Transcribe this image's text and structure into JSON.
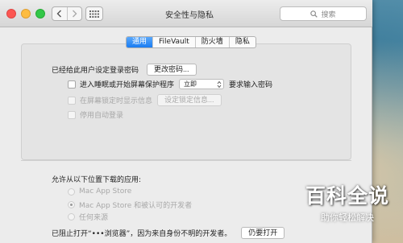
{
  "window": {
    "title": "安全性与隐私",
    "search_placeholder": "搜索"
  },
  "tabs": [
    {
      "label": "通用",
      "active": true
    },
    {
      "label": "FileVault",
      "active": false
    },
    {
      "label": "防火墙",
      "active": false
    },
    {
      "label": "隐私",
      "active": false
    }
  ],
  "general": {
    "password_set_text": "已经给此用户设定登录密码",
    "change_password_button": "更改密码...",
    "require_password_prefix": "进入睡眠或开始屏幕保护程序",
    "require_password_delay": "立即",
    "require_password_suffix": "要求输入密码",
    "show_message_label": "在屏幕锁定时显示信息",
    "set_lock_message_button": "设定锁定信息...",
    "disable_auto_login_label": "停用自动登录"
  },
  "downloads": {
    "heading": "允许从以下位置下载的应用:",
    "options": [
      {
        "label": "Mac App Store",
        "checked": false
      },
      {
        "label": "Mac App Store 和被认可的开发者",
        "checked": true
      },
      {
        "label": "任何来源",
        "checked": false
      }
    ],
    "blocked_text": "已阻止打开“•••浏览器”，因为来自身份不明的开发者。",
    "open_anyway_button": "仍要打开"
  },
  "watermark": {
    "main": "百科全说",
    "sub": "助你轻松解决"
  },
  "colors": {
    "accent": "#1a7cf2",
    "close": "#fc5753",
    "minimize": "#fdbc40",
    "zoom": "#33c748"
  }
}
